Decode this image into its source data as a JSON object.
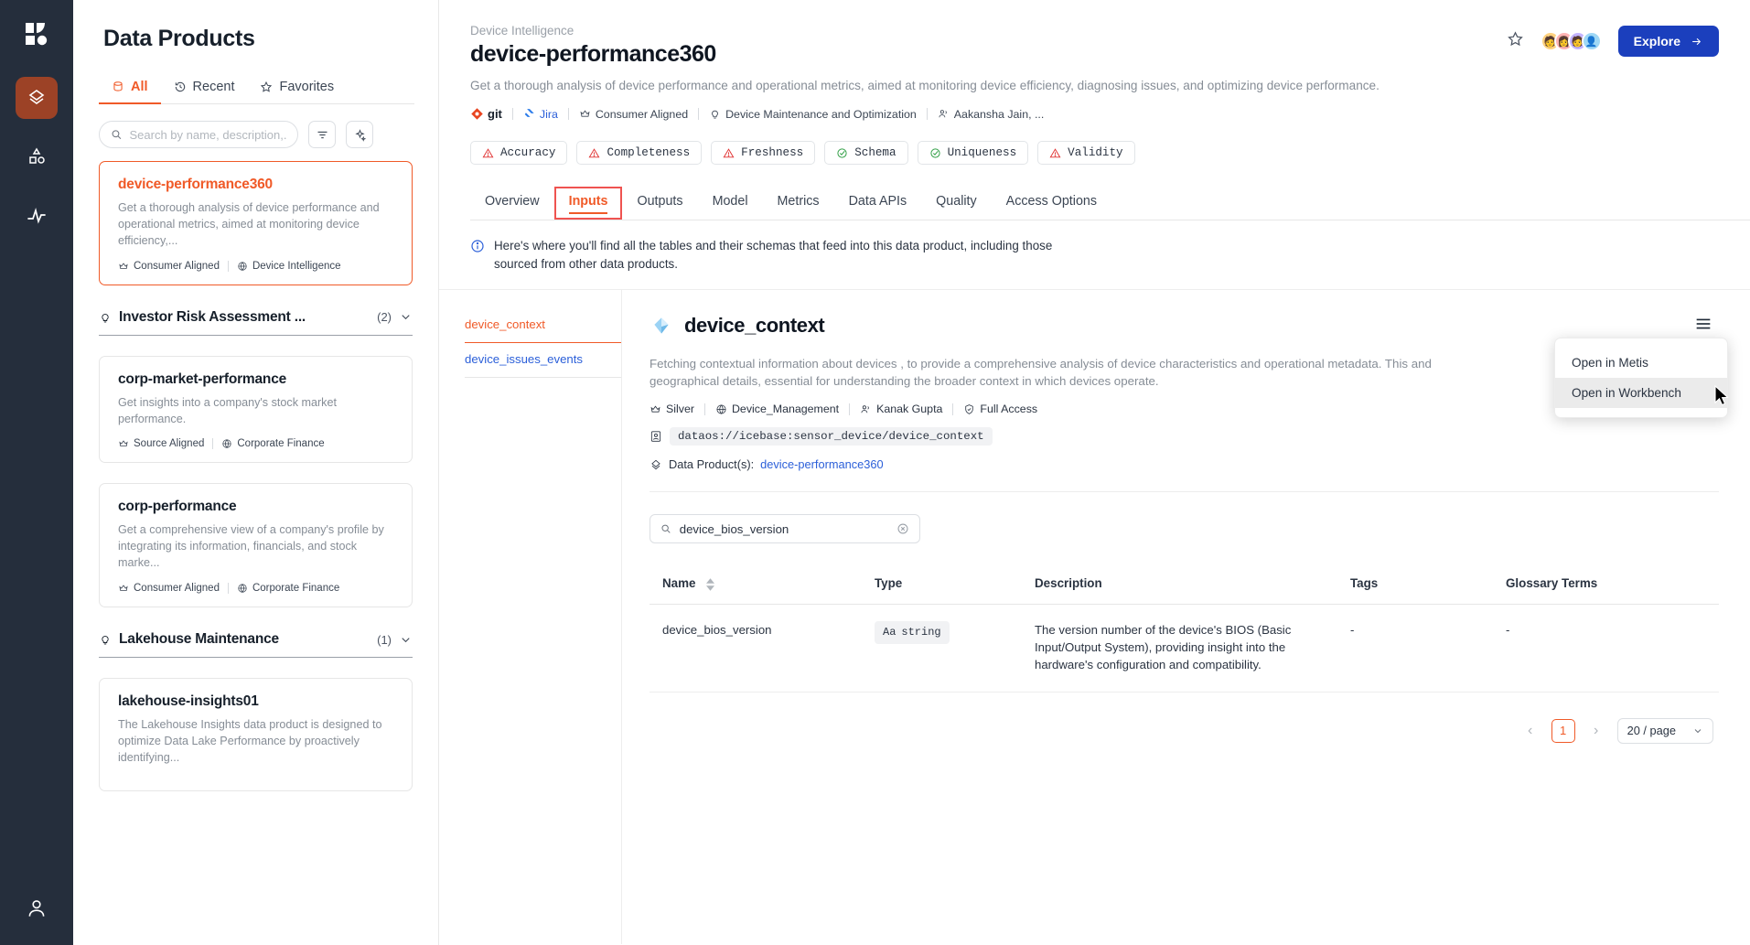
{
  "rail": {
    "logo": "metis-logo",
    "items": [
      {
        "name": "data-products-icon",
        "active": true
      },
      {
        "name": "assets-icon",
        "active": false
      },
      {
        "name": "activity-icon",
        "active": false
      }
    ],
    "bottom": {
      "name": "user-account-icon"
    }
  },
  "list_panel": {
    "title": "Data Products",
    "tabs": [
      {
        "label": "All",
        "icon": "database-icon",
        "active": true
      },
      {
        "label": "Recent",
        "icon": "history-icon",
        "active": false
      },
      {
        "label": "Favorites",
        "icon": "star-icon",
        "active": false
      }
    ],
    "search": {
      "placeholder": "Search by name, description,...",
      "value": ""
    },
    "filter_button": "filter-icon",
    "settings_button": "sparkle-icon",
    "cards": [
      {
        "name": "device-performance360",
        "description": "Get a thorough analysis of device performance and operational metrics, aimed at monitoring device efficiency,...",
        "alignment": "Consumer Aligned",
        "domain": "Device Intelligence",
        "selected": true
      }
    ],
    "groups": [
      {
        "title": "Investor Risk Assessment ...",
        "count": "(2)",
        "cards": [
          {
            "name": "corp-market-performance",
            "description": "Get insights into a company's stock market performance.",
            "alignment": "Source Aligned",
            "domain": "Corporate Finance"
          },
          {
            "name": "corp-performance",
            "description": "Get a comprehensive view of a company's profile by integrating its information, financials, and stock marke...",
            "alignment": "Consumer Aligned",
            "domain": "Corporate Finance"
          }
        ]
      },
      {
        "title": "Lakehouse Maintenance",
        "count": "(1)",
        "cards": [
          {
            "name": "lakehouse-insights01",
            "description": "The Lakehouse Insights data product is designed to optimize Data Lake Performance by proactively identifying...",
            "alignment": "",
            "domain": ""
          }
        ]
      }
    ]
  },
  "header": {
    "breadcrumb": "Device Intelligence",
    "title": "device-performance360",
    "description": "Get a thorough analysis of device performance and operational metrics, aimed at monitoring device efficiency, diagnosing issues, and optimizing device performance.",
    "meta": {
      "git": "git",
      "jira": "Jira",
      "alignment": "Consumer Aligned",
      "use_case": "Device Maintenance and Optimization",
      "owners": "Aakansha Jain, ..."
    },
    "star_icon": "star-icon",
    "explore_button": "Explore"
  },
  "quality": [
    {
      "label": "Accuracy",
      "status": "warning"
    },
    {
      "label": "Completeness",
      "status": "warning"
    },
    {
      "label": "Freshness",
      "status": "warning"
    },
    {
      "label": "Schema",
      "status": "ok"
    },
    {
      "label": "Uniqueness",
      "status": "ok"
    },
    {
      "label": "Validity",
      "status": "warning"
    }
  ],
  "tabs": [
    {
      "label": "Overview",
      "active": false
    },
    {
      "label": "Inputs",
      "active": true
    },
    {
      "label": "Outputs",
      "active": false
    },
    {
      "label": "Model",
      "active": false
    },
    {
      "label": "Metrics",
      "active": false
    },
    {
      "label": "Data APIs",
      "active": false
    },
    {
      "label": "Quality",
      "active": false
    },
    {
      "label": "Access Options",
      "active": false
    }
  ],
  "info_banner": {
    "icon": "info-icon",
    "text": "Here's where you'll find all the tables and their schemas that feed into this data product, including those sourced from other data products."
  },
  "table_list": [
    {
      "label": "device_context",
      "active": true
    },
    {
      "label": "device_issues_events",
      "active": false
    }
  ],
  "detail": {
    "icon": "iceberg-icon",
    "title": "device_context",
    "description": "Fetching contextual information about devices , to provide a comprehensive analysis of device characteristics and operational metadata. This and geographical details, essential for understanding the broader context in which devices operate.",
    "meta": {
      "tier": "Silver",
      "domain": "Device_Management",
      "owner": "Kanak Gupta",
      "access": "Full Access"
    },
    "uri": "dataos://icebase:sensor_device/device_context",
    "data_products_label": "Data Product(s):",
    "data_product_link": "device-performance360",
    "kebab_menu": "more-options-icon"
  },
  "context_menu": {
    "items": [
      {
        "label": "Open in Metis",
        "hover": false
      },
      {
        "label": "Open in Workbench",
        "hover": true
      }
    ]
  },
  "column_search": {
    "value": "device_bios_version",
    "placeholder": "Search"
  },
  "columns_table": {
    "headers": [
      "Name",
      "Type",
      "Description",
      "Tags",
      "Glossary Terms"
    ],
    "rows": [
      {
        "name": "device_bios_version",
        "type": "string",
        "type_icon": "Aa",
        "description": "The version number of the device's BIOS (Basic Input/Output System), providing insight into the hardware's configuration and compatibility.",
        "tags": "-",
        "glossary_terms": "-"
      }
    ]
  },
  "pagination": {
    "prev": "‹",
    "next": "›",
    "current_page": "1",
    "page_size": "20 / page"
  },
  "colors": {
    "accent": "#f05a28",
    "link": "#2b5fd9",
    "rail_bg": "#252e3c",
    "rail_active": "#9c4226",
    "explore_bg": "#1b3fbd",
    "warning": "#e03131",
    "ok": "#2f9e44"
  }
}
